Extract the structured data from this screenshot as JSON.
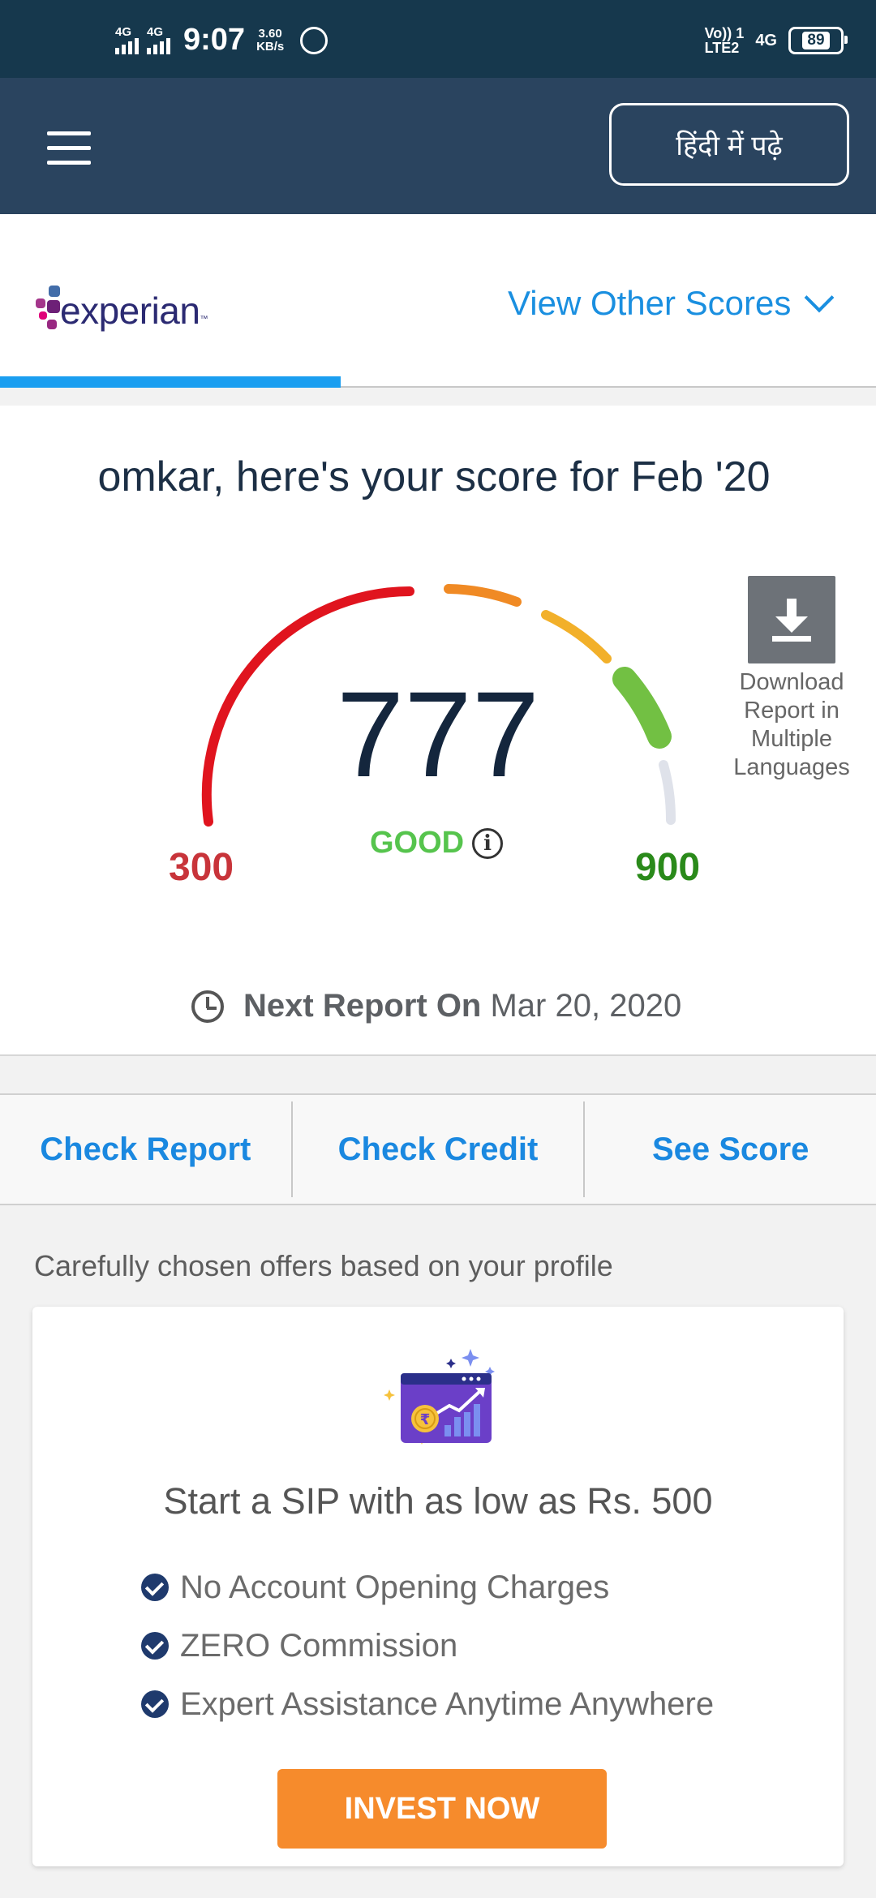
{
  "status_bar": {
    "net1": "4G",
    "net2": "4G",
    "time": "9:07",
    "speed_value": "3.60",
    "speed_unit": "KB/s",
    "volte_line1": "Vo)) 1",
    "volte_line2": "LTE2",
    "net3": "4G",
    "battery": "89"
  },
  "app_bar": {
    "language_button": "हिंदी में पढ़े"
  },
  "bureau": {
    "logo_text": "experian",
    "logo_tm": "™",
    "view_other_scores": "View Other Scores",
    "logo_colors": [
      "#426da9",
      "#a4368b",
      "#6d2077",
      "#e0007a",
      "#982881"
    ]
  },
  "score": {
    "greeting": "omkar, here's your score for Feb '20",
    "value": "777",
    "value_num": 777,
    "rating": "GOOD",
    "info_symbol": "i",
    "min": "300",
    "max": "900",
    "min_num": 300,
    "max_num": 900,
    "download_label": "Download Report in Multiple Languages",
    "next_report_label": "Next Report On",
    "next_report_date": "Mar 20, 2020",
    "segment_colors": [
      "#e0141e",
      "#f08a24",
      "#f2b02a",
      "#72c043",
      "#dfe2ea"
    ]
  },
  "quick_links": {
    "check_report": "Check Report",
    "check_credit": "Check Credit",
    "see_score": "See Score"
  },
  "offers": {
    "title": "Carefully chosen offers based on your profile",
    "headline": "Start a SIP with as low as Rs. 500",
    "benefits": [
      "No Account Opening Charges",
      "ZERO Commission",
      "Expert Assistance Anytime Anywhere"
    ],
    "cta": "INVEST NOW",
    "rupee_symbol": "₹"
  }
}
